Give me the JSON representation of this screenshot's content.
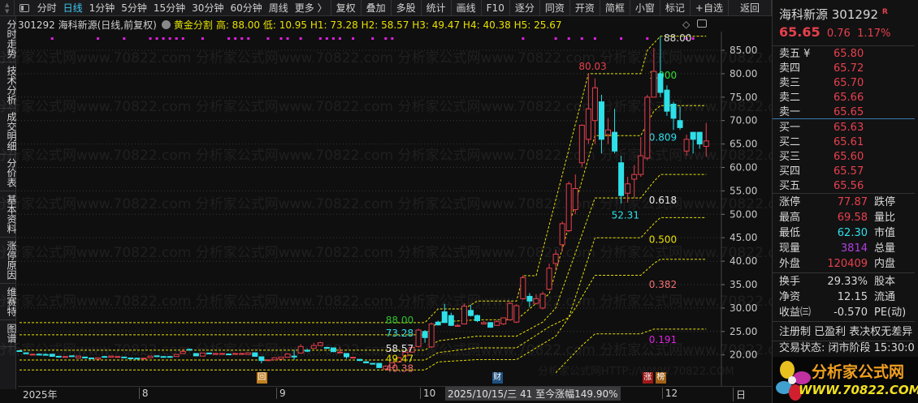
{
  "toolbar": {
    "period_tabs": [
      "分时",
      "日线",
      "1分钟",
      "5分钟",
      "15分钟",
      "30分钟",
      "60分钟",
      "周线",
      "更多 〉"
    ],
    "active_tab": "日线",
    "buttons": [
      "复权",
      "叠加",
      "多股",
      "统计",
      "画线",
      "F10",
      "逐分",
      "同资",
      "开资",
      "简框",
      "小窗",
      "标记",
      "+自选",
      "返回"
    ]
  },
  "infobar": {
    "title": "301292 海科新源(日线,前复权)",
    "indicator": "黄金分割",
    "values": "高: 88.00 低: 10.95 H1: 73.28 H2: 58.57 H3: 49.47 H4: 40.38 H5: 25.67"
  },
  "side_tabs": [
    "分时走势",
    "技术分析",
    "成交明细",
    "分价表",
    "基本资料",
    "涨停原因",
    "维赛特",
    "图谱"
  ],
  "watermark": "分析家公式网www.70822.com 分析家公式网www.70822.com 分析家公式网www.70822.com 分析家公式网www.70822.com",
  "watermark2": "分析家公式网HTTP://WWW.70822.COM",
  "colors": {
    "up": "#e8404c",
    "down": "#2ee0e8",
    "fib": "#e8e000",
    "marker": "#e020e0",
    "bg": "#0f0f10"
  },
  "chart_data": {
    "type": "candlestick",
    "ylim": [
      16,
      90
    ],
    "y_ticks": [
      "85.00",
      "80.00",
      "75.00",
      "70.00",
      "65.00",
      "60.00",
      "55.00",
      "50.00",
      "45.00",
      "40.00",
      "35.00",
      "30.00",
      "25.00",
      "20.00"
    ],
    "x_ticks": [
      {
        "label": "2025年",
        "idx": 0
      },
      {
        "label": "8",
        "idx": 18
      },
      {
        "label": "9",
        "idx": 39
      },
      {
        "label": "10",
        "idx": 61
      },
      {
        "label": "12",
        "idx": 98
      },
      {
        "label": "日",
        "idx": 109
      }
    ],
    "cursor_tip": "2025/10/15/三 41 至今涨幅149.90%",
    "candles": [
      [
        20.9,
        20.75,
        21.0,
        20.7
      ],
      [
        20.45,
        20.25,
        20.5,
        20.2
      ],
      [
        20.05,
        20.15,
        20.2,
        20.0
      ],
      [
        20.15,
        20.05,
        20.3,
        19.95
      ],
      [
        20.1,
        20.0,
        20.3,
        19.9
      ],
      [
        20.15,
        19.7,
        20.2,
        19.6
      ],
      [
        19.7,
        19.55,
        19.8,
        19.5
      ],
      [
        19.5,
        19.65,
        19.7,
        19.45
      ],
      [
        19.8,
        19.7,
        19.85,
        19.6
      ],
      [
        19.35,
        19.75,
        19.8,
        19.3
      ],
      [
        19.55,
        19.35,
        19.6,
        19.3
      ],
      [
        19.35,
        19.2,
        19.4,
        19.15
      ],
      [
        19.1,
        19.4,
        19.45,
        19.05
      ],
      [
        19.65,
        19.55,
        19.8,
        19.5
      ],
      [
        19.5,
        19.75,
        19.8,
        19.45
      ],
      [
        19.6,
        19.65,
        19.75,
        19.55
      ],
      [
        19.55,
        19.4,
        19.6,
        19.3
      ],
      [
        19.35,
        19.25,
        19.45,
        19.2
      ],
      [
        19.3,
        19.2,
        19.4,
        19.1
      ],
      [
        19.3,
        19.3,
        19.4,
        19.2
      ],
      [
        19.4,
        19.75,
        19.8,
        19.35
      ],
      [
        19.8,
        19.7,
        19.9,
        19.65
      ],
      [
        19.65,
        19.6,
        19.75,
        19.5
      ],
      [
        19.65,
        19.6,
        19.8,
        19.55
      ],
      [
        19.65,
        20.1,
        20.15,
        19.6
      ],
      [
        20.3,
        20.75,
        21.3,
        20.25
      ],
      [
        21.2,
        21.1,
        21.3,
        20.9
      ],
      [
        20.3,
        19.8,
        20.35,
        19.75
      ],
      [
        19.75,
        20.4,
        20.45,
        19.7
      ],
      [
        20.4,
        20.3,
        20.5,
        20.2
      ],
      [
        20.2,
        20.3,
        20.4,
        20.1
      ],
      [
        20.2,
        20.3,
        20.35,
        20.15
      ],
      [
        20.2,
        20.1,
        20.3,
        20.0
      ],
      [
        20.2,
        20.3,
        20.4,
        20.1
      ],
      [
        20.2,
        20.3,
        20.35,
        20.15
      ],
      [
        20.1,
        20.45,
        20.5,
        20.0
      ],
      [
        20.45,
        19.7,
        20.5,
        19.6
      ],
      [
        19.6,
        18.8,
        19.65,
        18.2
      ],
      [
        18.8,
        18.95,
        19.0,
        18.75
      ],
      [
        18.95,
        19.4,
        19.45,
        18.9
      ],
      [
        19.1,
        19.55,
        19.6,
        19.05
      ],
      [
        19.5,
        20.2,
        20.3,
        19.45
      ],
      [
        19.75,
        19.55,
        21.1,
        19.0
      ],
      [
        20.4,
        21.8,
        22.3,
        20.3
      ],
      [
        21.0,
        20.8,
        21.3,
        20.6
      ],
      [
        21.4,
        22.0,
        22.6,
        21.3
      ],
      [
        22.0,
        22.6,
        22.8,
        21.9
      ],
      [
        21.6,
        21.4,
        21.7,
        21.3
      ],
      [
        21.5,
        20.7,
        21.6,
        20.6
      ],
      [
        20.5,
        20.6,
        21.7,
        20.4
      ],
      [
        20.3,
        19.6,
        20.4,
        19.2
      ],
      [
        19.45,
        19.5,
        19.6,
        19.3
      ],
      [
        19.05,
        18.8,
        19.1,
        18.7
      ],
      [
        18.55,
        18.3,
        18.6,
        18.2
      ],
      [
        18.2,
        18.1,
        18.3,
        18.0
      ],
      [
        18.2,
        17.3,
        18.25,
        17.2
      ],
      [
        17.0,
        17.6,
        17.8,
        16.9
      ],
      [
        17.3,
        18.3,
        18.4,
        17.2
      ],
      [
        18.5,
        19.4,
        19.6,
        18.4
      ],
      [
        19.8,
        20.6,
        20.8,
        19.6
      ],
      [
        20.6,
        21.6,
        21.8,
        20.5
      ],
      [
        21.8,
        25.3,
        25.6,
        21.6
      ],
      [
        25.0,
        23.7,
        25.3,
        22.6
      ],
      [
        21.7,
        26.6,
        26.9,
        21.5
      ],
      [
        27.0,
        26.4,
        27.3,
        26.3
      ],
      [
        29.2,
        26.9,
        30.9,
        26.8
      ],
      [
        28.4,
        26.3,
        29.0,
        26.2
      ],
      [
        26.1,
        26.3,
        26.6,
        26.0
      ],
      [
        26.6,
        30.4,
        31.0,
        26.5
      ],
      [
        29.5,
        28.4,
        30.7,
        28.2
      ],
      [
        28.4,
        27.3,
        28.6,
        27.0
      ],
      [
        26.6,
        26.9,
        27.2,
        26.5
      ],
      [
        26.9,
        25.9,
        27.0,
        25.8
      ],
      [
        26.3,
        27.1,
        27.4,
        26.2
      ],
      [
        26.6,
        27.9,
        28.0,
        26.4
      ],
      [
        27.5,
        31,
        31.3,
        27.3
      ],
      [
        27,
        30.5,
        30.8,
        26.8
      ],
      [
        32,
        36.5,
        37,
        31.8
      ],
      [
        32.5,
        31.5,
        33.2,
        30.2
      ],
      [
        31,
        32,
        33,
        30.8
      ],
      [
        30,
        33,
        33.5,
        29.7
      ],
      [
        34,
        38.5,
        39.5,
        33.8
      ],
      [
        39.5,
        41.5,
        42.5,
        38
      ],
      [
        43.5,
        48,
        48.5,
        42
      ],
      [
        46.5,
        56.5,
        57,
        46.2
      ],
      [
        51,
        55.5,
        58.5,
        50
      ],
      [
        61,
        69,
        69.2,
        60
      ],
      [
        66,
        72.5,
        80.03,
        65
      ],
      [
        70,
        77,
        79,
        65
      ],
      [
        74,
        66,
        75.5,
        63
      ],
      [
        67,
        68,
        70.5,
        65
      ],
      [
        67.5,
        63.5,
        72.5,
        63
      ],
      [
        61,
        54,
        62.5,
        52.31
      ],
      [
        54.5,
        56.5,
        58,
        52.5
      ],
      [
        57.5,
        58.5,
        60.5,
        53.5
      ],
      [
        58.5,
        62.5,
        66.5,
        58
      ],
      [
        62,
        75,
        75.5,
        61.5
      ],
      [
        75,
        80.5,
        85.5,
        75
      ],
      [
        80,
        76,
        88,
        75
      ],
      [
        76.5,
        72,
        77.5,
        71
      ],
      [
        73.5,
        70.5,
        74,
        68
      ],
      [
        70,
        68.5,
        73,
        68
      ],
      [
        63.5,
        66,
        67,
        62.5
      ],
      [
        67.5,
        66,
        67.5,
        63
      ],
      [
        67.5,
        65,
        67.5,
        64
      ],
      [
        64.5,
        65.65,
        69.5,
        62.3
      ]
    ],
    "fib_lines": [
      {
        "level": "1.000",
        "color": "#30e030",
        "label_idx": 96,
        "label_price": 79.6,
        "points": [
          [
            0,
            26.9
          ],
          [
            62,
            26.9
          ],
          [
            64,
            29.8
          ],
          [
            68,
            29.8
          ],
          [
            70,
            31.5
          ],
          [
            76,
            31.5
          ],
          [
            77,
            36.9
          ],
          [
            79,
            36.9
          ],
          [
            87,
            80
          ],
          [
            95,
            80
          ],
          [
            96,
            85
          ],
          [
            98,
            88
          ],
          [
            105,
            88
          ]
        ]
      },
      {
        "level": "0.809",
        "color": "#2ee0e8",
        "label_idx": 96,
        "label_price": 66.4,
        "points": [
          [
            0,
            24.3
          ],
          [
            62,
            24.3
          ],
          [
            64,
            27
          ],
          [
            70,
            27.5
          ],
          [
            76,
            27.5
          ],
          [
            79,
            31
          ],
          [
            81,
            33
          ],
          [
            88,
            66.8
          ],
          [
            95,
            66.8
          ],
          [
            97,
            72
          ],
          [
            98,
            73.2
          ],
          [
            105,
            73.2
          ]
        ]
      },
      {
        "level": "0.618",
        "color": "#e8e8e8",
        "label_idx": 96,
        "label_price": 53.0,
        "points": [
          [
            0,
            21.0
          ],
          [
            62,
            21.0
          ],
          [
            64,
            23
          ],
          [
            70,
            24
          ],
          [
            76,
            24
          ],
          [
            80,
            27
          ],
          [
            82,
            30
          ],
          [
            88,
            53.5
          ],
          [
            95,
            53.5
          ],
          [
            97,
            57
          ],
          [
            98,
            58.5
          ],
          [
            105,
            58.5
          ]
        ]
      },
      {
        "level": "0.500",
        "color": "#e8e000",
        "label_idx": 96,
        "label_price": 44.6,
        "points": [
          [
            0,
            18.9
          ],
          [
            62,
            18.9
          ],
          [
            64,
            20.5
          ],
          [
            70,
            21.5
          ],
          [
            76,
            21.5
          ],
          [
            81,
            26
          ],
          [
            84,
            28
          ],
          [
            88,
            45
          ],
          [
            95,
            45
          ],
          [
            97,
            48
          ],
          [
            98,
            49.3
          ],
          [
            105,
            49.3
          ]
        ]
      },
      {
        "level": "0.382",
        "color": "#f07070",
        "label_idx": 96,
        "label_price": 35.0,
        "points": [
          [
            0,
            16.8
          ],
          [
            62,
            16.8
          ],
          [
            64,
            18.5
          ],
          [
            70,
            19
          ],
          [
            76,
            19
          ],
          [
            82,
            24
          ],
          [
            85,
            30
          ],
          [
            88,
            37
          ],
          [
            95,
            37
          ],
          [
            97,
            39.5
          ],
          [
            98,
            40.4
          ],
          [
            105,
            40.4
          ]
        ]
      },
      {
        "level": "0.191",
        "color": "#e020e0",
        "label_idx": 96,
        "label_price": 23.2,
        "points": [
          [
            82,
            16.2
          ],
          [
            86,
            22
          ],
          [
            88,
            24.5
          ],
          [
            95,
            24.5
          ],
          [
            97,
            25.5
          ],
          [
            105,
            25.5
          ]
        ]
      }
    ],
    "left_labels": [
      {
        "text": "88.00",
        "color": "#30c030",
        "price": 27.4
      },
      {
        "text": "73.28",
        "color": "#2ee0e8",
        "price": 24.6
      },
      {
        "text": "58.57",
        "color": "#e8e8e8",
        "price": 21.3
      },
      {
        "text": "49.47",
        "color": "#e8e000",
        "price": 19.2
      },
      {
        "text": "40.38",
        "color": "#f07070",
        "price": 17.1
      }
    ],
    "annotations": [
      {
        "text": "80.03",
        "color": "#e8404c",
        "idx": 87,
        "price": 81.5
      },
      {
        "text": "52.31",
        "color": "#2ee0e8",
        "idx": 92,
        "price": 49.8
      },
      {
        "text": "88.00",
        "color": "#d8d8d8",
        "idx": 100,
        "price": 87.6
      }
    ],
    "marker_dots": [
      5,
      12,
      16,
      20,
      21,
      22,
      23,
      24,
      25,
      28,
      32,
      33,
      34,
      35,
      38,
      40,
      41,
      43,
      46,
      47,
      48,
      49,
      51,
      54,
      56,
      57,
      77,
      82,
      84,
      86,
      88,
      92,
      96,
      102,
      103
    ],
    "event_markers": [
      {
        "text": "回",
        "idx": 37,
        "color": "#c08020"
      },
      {
        "text": "财",
        "idx": 73,
        "color": "#205080"
      },
      {
        "text": "涨",
        "idx": 96,
        "color": "#a01818"
      },
      {
        "text": "榜",
        "idx": 98,
        "color": "#a06018"
      }
    ]
  },
  "quote": {
    "name_code": "海科新源 301292",
    "badge": "R",
    "price": "65.65",
    "change": "0.76",
    "pct": "1.17%",
    "sell": [
      {
        "label": "卖五 ¥",
        "price": "65.80"
      },
      {
        "label": "卖四",
        "price": "65.72"
      },
      {
        "label": "卖三",
        "price": "65.70"
      },
      {
        "label": "卖二",
        "price": "65.66"
      },
      {
        "label": "卖一",
        "price": "65.65"
      }
    ],
    "buy": [
      {
        "label": "买一",
        "price": "65.63"
      },
      {
        "label": "买二",
        "price": "65.61"
      },
      {
        "label": "买三",
        "price": "65.60"
      },
      {
        "label": "买四",
        "price": "65.57"
      },
      {
        "label": "买五",
        "price": "65.56"
      }
    ],
    "stats1": [
      {
        "label": "涨停",
        "value": "77.87",
        "label2": "跌停"
      },
      {
        "label": "最高",
        "value": "69.58",
        "label2": "量比"
      },
      {
        "label": "最低",
        "value": "62.30",
        "label2": "市值"
      },
      {
        "label": "现量",
        "value": "3814",
        "label2": "总量"
      },
      {
        "label": "外盘",
        "value": "120409",
        "label2": "内盘"
      }
    ],
    "stats2": [
      {
        "label": "换手",
        "value": "29.33%",
        "label2": "股本"
      },
      {
        "label": "净资",
        "value": "12.15",
        "label2": "流通"
      },
      {
        "label": "收益㈢",
        "value": "-0.570",
        "label2": "PE(动)"
      }
    ],
    "tags": "注册制 已盈利 表决权无差异",
    "status": "交易状态: 闭市阶段 15:30:0",
    "logo_text": "分析家公式网",
    "logo_url": "WWW.70822.COM"
  }
}
